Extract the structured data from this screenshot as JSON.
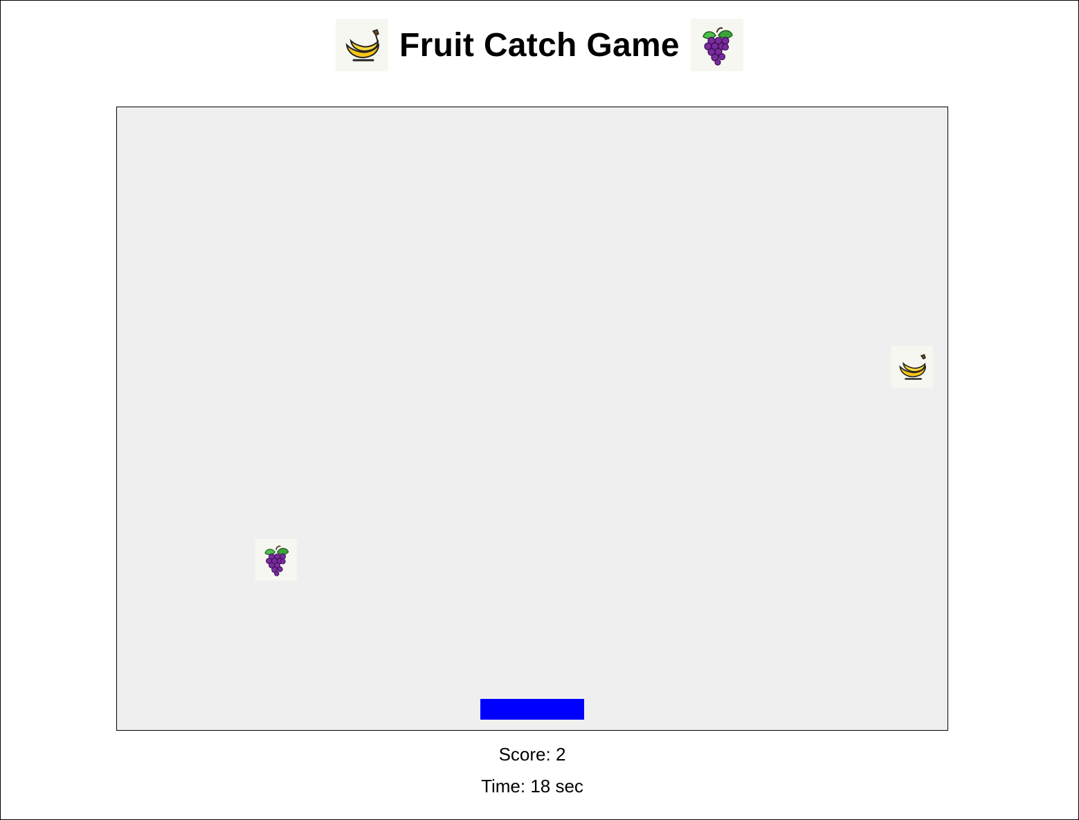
{
  "header": {
    "title": "Fruit Catch Game",
    "left_icon": "banana-icon",
    "right_icon": "grapes-icon"
  },
  "game": {
    "background_color": "#efefef",
    "paddle_color": "#0000ff",
    "fruits": [
      {
        "type": "banana",
        "icon": "banana-icon"
      },
      {
        "type": "grapes",
        "icon": "grapes-icon"
      }
    ]
  },
  "status": {
    "score_text": "Score: 2",
    "time_text": "Time: 18 sec"
  }
}
